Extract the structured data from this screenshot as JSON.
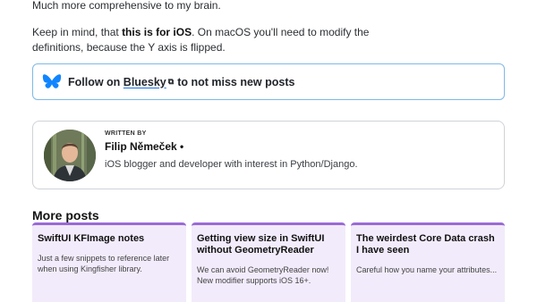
{
  "paragraphs": {
    "p1": "Much more comprehensive to my brain.",
    "p2_pre": "Keep in mind, that ",
    "p2_bold": "this is for iOS",
    "p2_post": ". On macOS you'll need to modify the definitions, because the Y axis is flipped."
  },
  "bluesky": {
    "pre": "Follow on ",
    "link": "Bluesky",
    "post": "to not miss new posts",
    "icon": "bluesky-butterfly-icon",
    "color": "#1185fe"
  },
  "author": {
    "written_by": "WRITTEN BY",
    "name": "Filip Němeček •",
    "bio": "iOS blogger and developer with interest in Python/Django."
  },
  "more_posts": {
    "title": "More posts",
    "posts": [
      {
        "title": "SwiftUI KFImage notes",
        "desc": "Just a few snippets to reference later when using Kingfisher library."
      },
      {
        "title": "Getting view size in SwiftUI without GeometryReader",
        "desc": "We can avoid GeometryReader now! New modifier supports iOS 16+."
      },
      {
        "title": "The weirdest Core Data crash I have seen",
        "desc": "Careful how you name your attributes..."
      }
    ]
  },
  "colors": {
    "card_bg": "#f2ebfb",
    "card_accent": "#9b6ad6",
    "bluesky_border": "#7fb9e6"
  }
}
